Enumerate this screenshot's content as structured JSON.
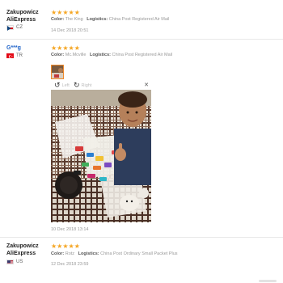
{
  "reviews": [
    {
      "name_lines": [
        "Zakupowicz",
        "AliExpress"
      ],
      "country_code": "CZ",
      "stars": "★★★★★",
      "color_label": "Color:",
      "color_value": "The King",
      "logistics_label": "Logistics:",
      "logistics_value": "China Post Registered Air Mail",
      "date": "14 Dec 2018 20:51"
    },
    {
      "name_lines": [
        "G***g"
      ],
      "country_code": "TR",
      "stars": "★★★★★",
      "color_label": "Color:",
      "color_value": "Mc.Mcville",
      "logistics_label": "Logistics:",
      "logistics_value": "China Post Registered Air Mail",
      "viewer": {
        "left_label": "Left",
        "right_label": "Right"
      },
      "date": "10 Dec 2018 13:14"
    },
    {
      "name_lines": [
        "Zakupowicz",
        "AliExpress"
      ],
      "country_code": "US",
      "stars": "★★★★★",
      "color_label": "Color:",
      "color_value": "Rotz",
      "logistics_label": "Logistics:",
      "logistics_value": "China Post Ordinary Small Packet Plus",
      "date": "12 Dec 2018 23:59"
    }
  ],
  "colors": {
    "star": "#f5a623",
    "link": "#1f63c9",
    "thumb_border": "#f08a2b"
  },
  "icons": [
    "rotate-left-icon",
    "rotate-right-icon",
    "close-icon"
  ]
}
